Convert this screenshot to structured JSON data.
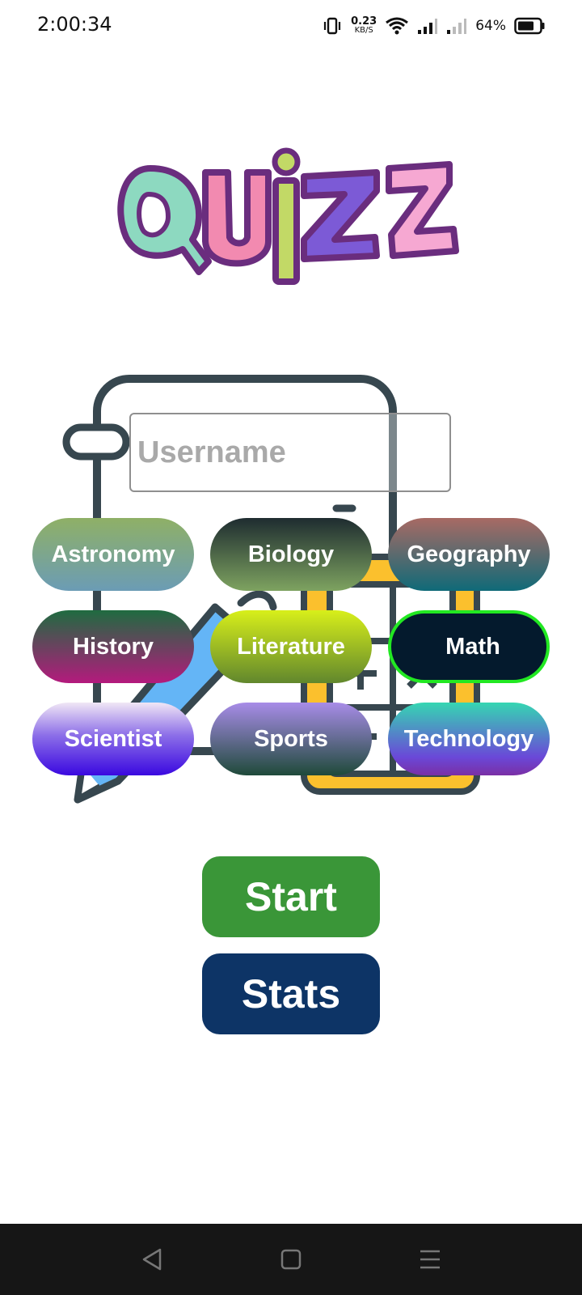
{
  "status_bar": {
    "time": "2:00:34",
    "net_speed_value": "0.23",
    "net_speed_unit": "KB/S",
    "battery_percent": "64%"
  },
  "logo": {
    "text": "QUiZZ"
  },
  "username": {
    "placeholder": "Username",
    "value": ""
  },
  "categories": [
    {
      "label": "Astronomy"
    },
    {
      "label": "Biology"
    },
    {
      "label": "Geography"
    },
    {
      "label": "History"
    },
    {
      "label": "Literature"
    },
    {
      "label": "Math",
      "selected": true,
      "selected_border_color": "#22e822"
    },
    {
      "label": "Scientist"
    },
    {
      "label": "Sports"
    },
    {
      "label": "Technology"
    }
  ],
  "actions": {
    "start_label": "Start",
    "stats_label": "Stats",
    "start_color": "#3a9638",
    "stats_color": "#0d3466"
  },
  "nav_bar": {
    "icons": [
      "back-triangle-icon",
      "home-square-icon",
      "menu-lines-icon"
    ]
  }
}
